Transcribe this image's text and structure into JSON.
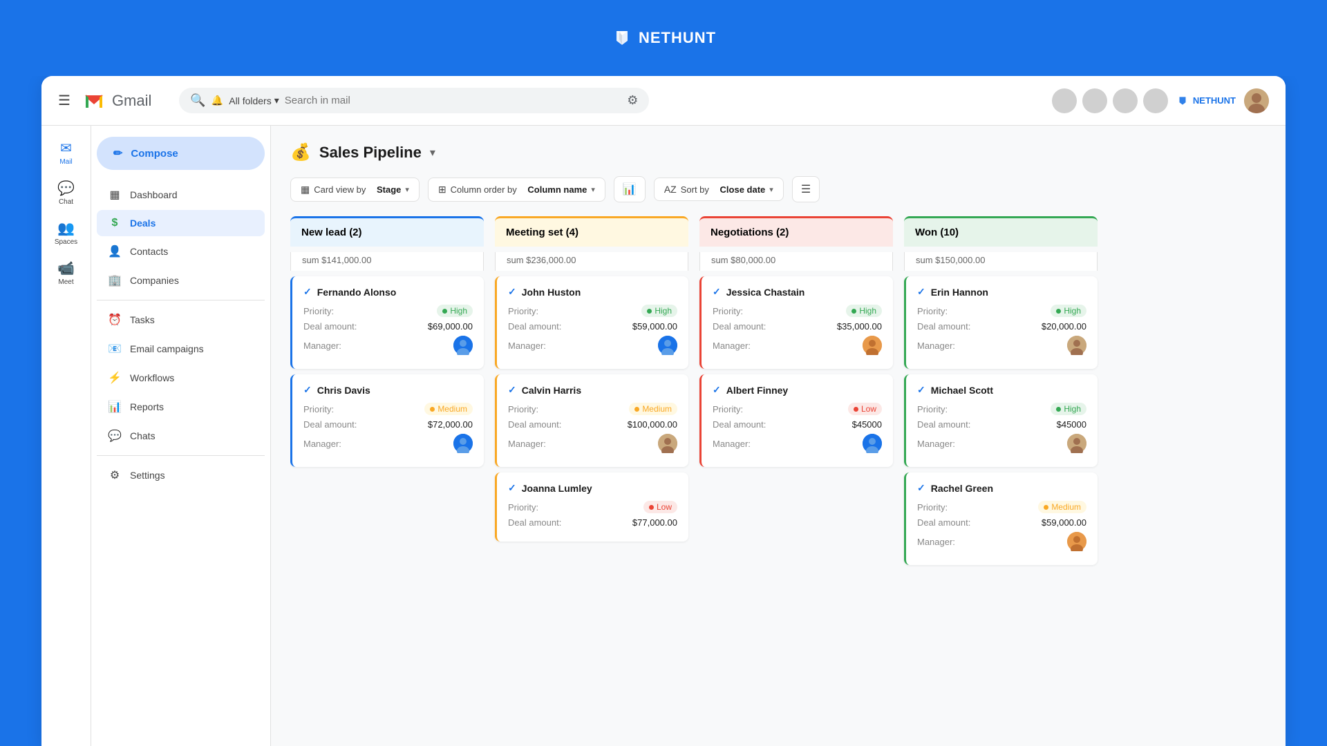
{
  "topbar": {
    "logo_text": "NETHUNT",
    "logo_icon": "🐦"
  },
  "gmail_header": {
    "brand": "Gmail",
    "search_placeholder": "Search in mail",
    "all_folders": "All folders",
    "nethunt_label": "NETHUNT"
  },
  "sidebar_icons": [
    {
      "id": "mail",
      "icon": "✉",
      "label": "Mail",
      "active": true
    },
    {
      "id": "chat",
      "icon": "💬",
      "label": "Chat",
      "active": false
    },
    {
      "id": "spaces",
      "icon": "👥",
      "label": "Spaces",
      "active": false
    },
    {
      "id": "meet",
      "icon": "📹",
      "label": "Meet",
      "active": false
    }
  ],
  "nav": {
    "compose_label": "Compose",
    "items": [
      {
        "id": "dashboard",
        "icon": "▦",
        "label": "Dashboard"
      },
      {
        "id": "deals",
        "icon": "$",
        "label": "Deals",
        "active": true
      },
      {
        "id": "contacts",
        "icon": "👤",
        "label": "Contacts"
      },
      {
        "id": "companies",
        "icon": "🏢",
        "label": "Companies"
      },
      {
        "id": "tasks",
        "icon": "⏰",
        "label": "Tasks"
      },
      {
        "id": "email-campaigns",
        "icon": "📧",
        "label": "Email campaigns"
      },
      {
        "id": "workflows",
        "icon": "⚡",
        "label": "Workflows"
      },
      {
        "id": "reports",
        "icon": "📊",
        "label": "Reports"
      },
      {
        "id": "chats",
        "icon": "💬",
        "label": "Chats"
      },
      {
        "id": "settings",
        "icon": "⚙",
        "label": "Settings"
      }
    ]
  },
  "pipeline": {
    "icon": "💰",
    "title": "Sales Pipeline",
    "view_label": "Card view by",
    "view_value": "Stage",
    "column_order_label": "Column order by",
    "column_order_value": "Column name",
    "sort_label": "Sort by",
    "sort_value": "Close date"
  },
  "columns": [
    {
      "id": "new-lead",
      "title": "New lead (2)",
      "color": "blue",
      "sum": "sum $141,000.00",
      "cards": [
        {
          "id": "fernando",
          "name": "Fernando Alonso",
          "priority": "High",
          "priority_type": "high",
          "deal_amount": "$69,000.00",
          "manager_avatar": "av-blue",
          "border": "blue"
        },
        {
          "id": "chris",
          "name": "Chris Davis",
          "priority": "Medium",
          "priority_type": "medium",
          "deal_amount": "$72,000.00",
          "manager_avatar": "av-blue",
          "border": "blue"
        }
      ]
    },
    {
      "id": "meeting-set",
      "title": "Meeting set (4)",
      "color": "orange",
      "sum": "sum $236,000.00",
      "cards": [
        {
          "id": "john",
          "name": "John Huston",
          "priority": "High",
          "priority_type": "high",
          "deal_amount": "$59,000.00",
          "manager_avatar": "av-blue",
          "border": "orange"
        },
        {
          "id": "calvin",
          "name": "Calvin Harris",
          "priority": "Medium",
          "priority_type": "medium",
          "deal_amount": "$100,000.00",
          "manager_avatar": "av-brown",
          "border": "orange"
        },
        {
          "id": "joanna",
          "name": "Joanna Lumley",
          "priority": "Low",
          "priority_type": "low",
          "deal_amount": "$77,000.00",
          "manager_avatar": "av-blue",
          "border": "orange"
        }
      ]
    },
    {
      "id": "negotiations",
      "title": "Negotiations (2)",
      "color": "red",
      "sum": "sum $80,000.00",
      "cards": [
        {
          "id": "jessica",
          "name": "Jessica Chastain",
          "priority": "High",
          "priority_type": "high",
          "deal_amount": "$35,000.00",
          "manager_avatar": "av-orange",
          "border": "red"
        },
        {
          "id": "albert",
          "name": "Albert Finney",
          "priority": "Low",
          "priority_type": "low",
          "deal_amount": "$45000",
          "manager_avatar": "av-blue",
          "border": "red"
        }
      ]
    },
    {
      "id": "won",
      "title": "Won (10)",
      "color": "green",
      "sum": "sum $150,000.00",
      "cards": [
        {
          "id": "erin",
          "name": "Erin Hannon",
          "priority": "High",
          "priority_type": "high",
          "deal_amount": "$20,000.00",
          "manager_avatar": "av-brown",
          "border": "green"
        },
        {
          "id": "michael",
          "name": "Michael Scott",
          "priority": "High",
          "priority_type": "high",
          "deal_amount": "$45000",
          "manager_avatar": "av-brown",
          "border": "green"
        },
        {
          "id": "rachel",
          "name": "Rachel Green",
          "priority": "Medium",
          "priority_type": "medium",
          "deal_amount": "$59,000.00",
          "manager_avatar": "av-orange",
          "border": "green"
        }
      ]
    }
  ],
  "labels": {
    "priority": "Priority:",
    "deal_amount": "Deal amount:",
    "manager": "Manager:",
    "check_icon": "✅"
  }
}
